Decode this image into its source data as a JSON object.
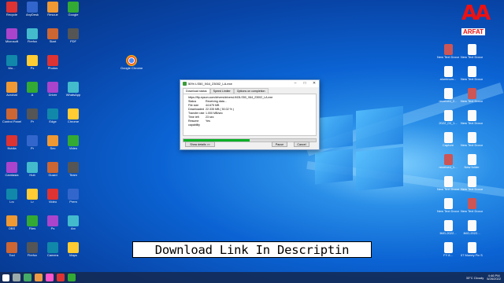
{
  "desktop": {
    "left_icons": [
      [
        "Recycle",
        "AnyDesk",
        "Rescue",
        "Google"
      ],
      [
        "Microsoft",
        "Firefox",
        "Start",
        "PDF"
      ],
      [
        "Mo...",
        "Ps",
        "Photos",
        "Google Chrome"
      ],
      [
        "Acrobat",
        "A",
        "Driver",
        "WhatsApp"
      ],
      [
        "Control Panel",
        "Pr",
        "Edge",
        "Chrome"
      ],
      [
        "Nvidia",
        "Pr",
        "Sec",
        "Video"
      ],
      [
        "Camtasia",
        "Hub",
        "Guard",
        "Team"
      ],
      [
        "Lrc",
        "Lr",
        "Video",
        "Prem"
      ],
      [
        "OBS",
        "Files",
        "Ps",
        "Arc"
      ],
      [
        "Tool",
        "Firefox",
        "Camera",
        "Maps"
      ]
    ],
    "right_icons": [
      "New Text Document",
      "New Text Document",
      "aluminum...",
      "New Text Document",
      "received_2...",
      "New Text Document",
      "2022_03_1...",
      "New Text Document",
      "Capture",
      "New Text Document",
      "received_1...",
      "New folder",
      "New Text Document",
      "New Text Document",
      "New Text Document",
      "New Text Document",
      "IMG-2022...",
      "IMG-2022...",
      "FY 8...",
      "07 Money Fix Sex..."
    ]
  },
  "dialog": {
    "title": "50% LS50_X64_23002_LA.exe",
    "tabs": [
      "Download status",
      "Speed Limiter",
      "Options on completion"
    ],
    "url": "https://ftp.epson.com/drivers/driversLK63LS50_X64_23002_LA.exe",
    "rows": [
      {
        "k": "Status",
        "v": "Receiving data..."
      },
      {
        "k": "File size",
        "v": "44.675 MB"
      },
      {
        "k": "Downloaded",
        "v": "22.335 MB ( 50.02 % )"
      },
      {
        "k": "Transfer rate",
        "v": "1.000 MB/sec"
      },
      {
        "k": "Time left",
        "v": "23 sec"
      },
      {
        "k": "Resume capability",
        "v": "Yes"
      }
    ],
    "progress_fraction": 0.5,
    "btn_details": "Show details >>",
    "btn_pause": "Pause",
    "btn_cancel": "Cancel"
  },
  "caption": "Download Link In Descriptin",
  "brand": {
    "big": "AA",
    "small": "ARFAT"
  },
  "tray": {
    "weather": "33°C Cloudy",
    "time": "4:46 PM",
    "date": "5/26/2022"
  },
  "colors": {
    "accent": "#06b025",
    "brand": "#e11111",
    "desktop": "#0b63d3"
  }
}
